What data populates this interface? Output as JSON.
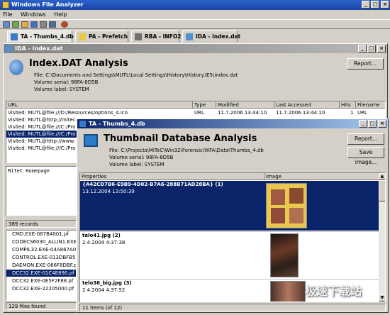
{
  "app": {
    "title": "Windows File Analyzer"
  },
  "menu": {
    "file": "File",
    "windows": "Windows",
    "help": "Help"
  },
  "tabs": [
    {
      "label": "TA - Thumbs_4.db",
      "icon": "thumbs-db-icon"
    },
    {
      "label": "PA - Prefetch",
      "icon": "prefetch-icon"
    },
    {
      "label": "RBA - INFO2",
      "icon": "recycle-bin-icon"
    },
    {
      "label": "IDA - index.dat",
      "icon": "index-dat-icon"
    }
  ],
  "ida": {
    "title": "IDA - index.dat",
    "heading": "Index.DAT Analysis",
    "file": "File: C:\\Documents and Settings\\MUTL\\Local Settings\\History\\History.IE5\\index.dat",
    "serial": "Volume serial: 98FA-8D5B",
    "label": "Volume label: SYSTEM",
    "report": "Report...",
    "columns": [
      "URL",
      "Type",
      "Modified",
      "Last Accessed",
      "Hits",
      "Filename"
    ],
    "first_row": {
      "url": "Visited: MUTL@file:///D:/Resources/options_4.ico",
      "type": "URL",
      "modified": "11.7.2006 13:44:10",
      "accessed": "11.7.2006 13:44:10",
      "hits": "1",
      "filename": "URL"
    },
    "rows": [
      "Visited: MUTL@http://mitec.",
      "Visited: MUTL@file:///C:/Pro",
      "Visited: MUTL@file:///C:/Pro",
      "Visited: MUTL@http://www.",
      "Visited: MUTL@file:///C:/Pro"
    ],
    "selected_row": 2,
    "preview": "MiTeC Homepage",
    "status": "389 records"
  },
  "pa": {
    "items": [
      "CMD.EXE-087B4001.pf",
      "CODECS6030_ALLIN1.EXE",
      "COMPIL32.EXE-04A867A0.p",
      "CONTROL.EXE-013DBFB5.p",
      "DAEMON.EXE-066F8DBF.pf",
      "DCC32.EXE-01C4E890.pf",
      "DCC32.EXE-0E5F2F88.pf",
      "DCC32.EXE-22205000.pf"
    ],
    "selected": 5,
    "status": "129 files found"
  },
  "ta": {
    "title": "TA - Thumbs_4.db",
    "heading": "Thumbnail Database Analysis",
    "file": "File: C:\\Projects\\MiTeC\\Win32\\Forensic\\WFA\\Data\\Thumbs_4.db",
    "serial": "Volume serial: 98FA-8D5B",
    "label": "Volume label: SYSTEM",
    "report": "Report...",
    "save_image": "Save image...",
    "col_properties": "Properties",
    "col_image": "Image",
    "entries": [
      {
        "name": "{A42CD7B6-E9B9-4D02-B7A6-288B71AD28BA} (1)",
        "date": "13.12.2004 13:50:39"
      },
      {
        "name": "telo41.jpg (2)",
        "date": "2.4.2004 4:37:38"
      },
      {
        "name": "telo36_big.jpg (3)",
        "date": "2.4.2004 4:37:52"
      }
    ],
    "status": "11 items (of 12)"
  },
  "watermark": "极速下载站"
}
